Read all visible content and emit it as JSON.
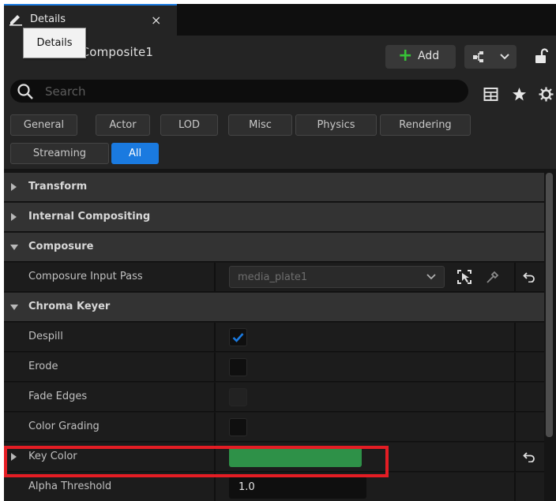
{
  "tab": {
    "title": "Details",
    "close": "×"
  },
  "tooltip": {
    "text": "Details"
  },
  "header": {
    "object_name": "gerComposite1",
    "add_label": "Add"
  },
  "search": {
    "placeholder": "Search",
    "value": ""
  },
  "filters": [
    "General",
    "Actor",
    "LOD",
    "Misc",
    "Physics",
    "Rendering",
    "Streaming",
    "All"
  ],
  "active_filter": "All",
  "categories": {
    "transform": "Transform",
    "internal": "Internal Compositing",
    "composure": "Composure",
    "chroma": "Chroma Keyer"
  },
  "properties": {
    "input_pass": {
      "label": "Composure Input Pass",
      "value": "media_plate1"
    },
    "despill": {
      "label": "Despill",
      "checked": true
    },
    "erode": {
      "label": "Erode",
      "checked": false
    },
    "fade_edges": {
      "label": "Fade Edges",
      "checked": false
    },
    "color_grading": {
      "label": "Color Grading",
      "checked": false
    },
    "key_color": {
      "label": "Key Color",
      "color": "#2e9148"
    },
    "alpha_threshold": {
      "label": "Alpha Threshold",
      "value": "1.0"
    }
  },
  "colors": {
    "accent": "#1a7ae0",
    "add_plus": "#37c337",
    "highlight": "#e41d24"
  },
  "icons": [
    "details-pencil-icon",
    "close-icon",
    "plus-icon",
    "blueprint-icon",
    "chevron-down-icon",
    "lock-icon",
    "search-icon",
    "table-icon",
    "star-icon",
    "gear-icon",
    "pick-actor-icon",
    "eyedropper-icon",
    "reset-arrow-icon",
    "checkmark-icon"
  ]
}
